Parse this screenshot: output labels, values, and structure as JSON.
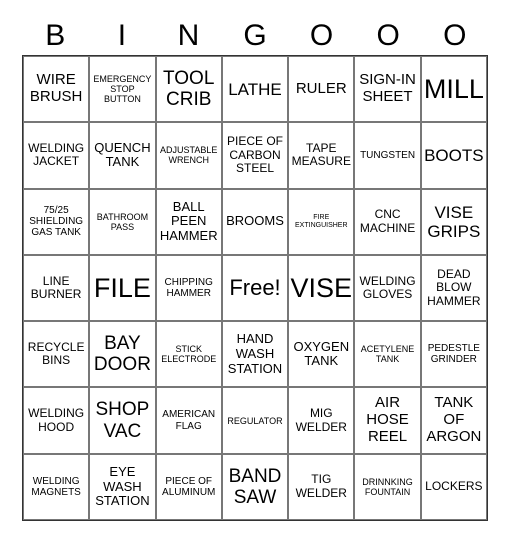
{
  "header": [
    "B",
    "I",
    "N",
    "G",
    "O",
    "O",
    "O"
  ],
  "cells": [
    [
      "WIRE BRUSH",
      "EMERGENCY STOP BUTTON",
      "TOOL CRIB",
      "LATHE",
      "RULER",
      "SIGN-IN SHEET",
      "MILL"
    ],
    [
      "WELDING JACKET",
      "QUENCH TANK",
      "ADJUSTABLE WRENCH",
      "PIECE OF CARBON STEEL",
      "TAPE MEASURE",
      "TUNGSTEN",
      "BOOTS"
    ],
    [
      "75/25 SHIELDING GAS TANK",
      "BATHROOM PASS",
      "BALL PEEN HAMMER",
      "BROOMS",
      "FIRE EXTINGUISHER",
      "CNC MACHINE",
      "VISE GRIPS"
    ],
    [
      "LINE BURNER",
      "FILE",
      "CHIPPING HAMMER",
      "Free!",
      "VISE",
      "WELDING GLOVES",
      "DEAD BLOW HAMMER"
    ],
    [
      "RECYCLE BINS",
      "BAY DOOR",
      "STICK ELECTRODE",
      "HAND WASH STATION",
      "OXYGEN TANK",
      "ACETYLENE TANK",
      "PEDESTLE GRINDER"
    ],
    [
      "WELDING HOOD",
      "SHOP VAC",
      "AMERICAN FLAG",
      "REGULATOR",
      "MIG WELDER",
      "AIR HOSE REEL",
      "TANK OF ARGON"
    ],
    [
      "WELDING MAGNETS",
      "EYE WASH STATION",
      "PIECE OF ALUMINUM",
      "BAND SAW",
      "TIG WELDER",
      "DRINNKING FOUNTAIN",
      "LOCKERS"
    ]
  ]
}
